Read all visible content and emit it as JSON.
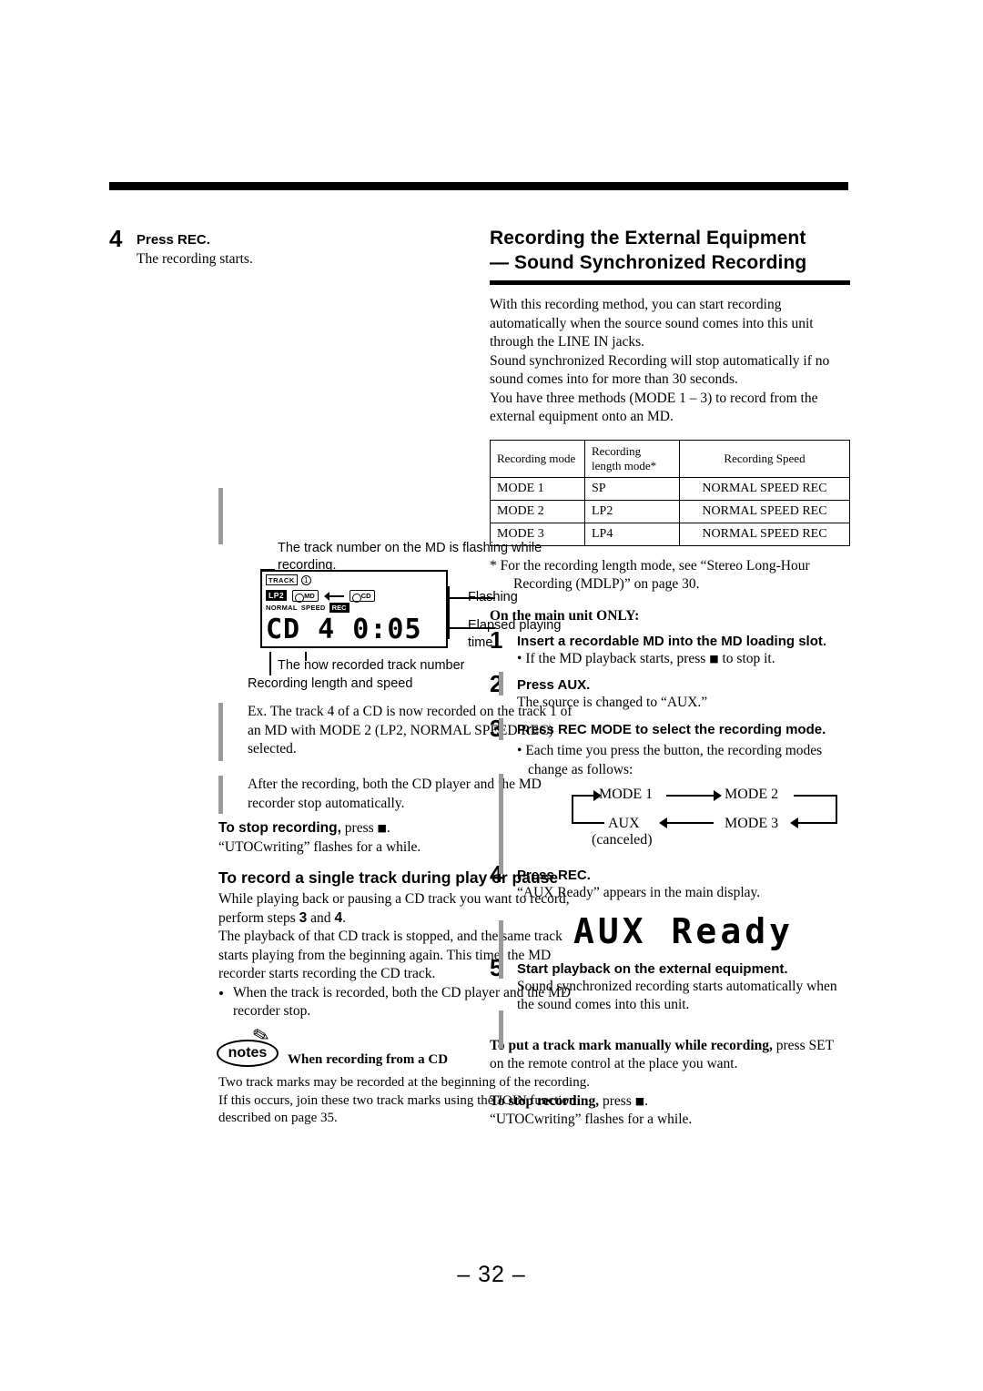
{
  "page_number": "– 32 –",
  "left": {
    "step4": {
      "num": "4",
      "head": "Press REC.",
      "body": "The recording starts."
    },
    "callout_track_flash": "The track number on the MD is flashing while recording.",
    "callout_flashing": "Flashing",
    "callout_elapsed": "Elapsed playing time",
    "callout_now_recorded": "The now recorded track number",
    "callout_length_speed": "Recording length and speed",
    "lcd": {
      "track_label": "TRACK",
      "track_circle": "1",
      "lp2": "LP2",
      "md": "MD",
      "cd": "CD",
      "normal": "NORMAL",
      "speed": "SPEED",
      "rec": "REC",
      "main_text": "CD  4  0:05"
    },
    "example": "Ex. The track 4 of a CD is now recorded on the track 1 of an MD with MODE 2 (LP2, NORMAL SPEED REC) selected.",
    "after_rec": "After the recording, both the CD player and the MD recorder stop automatically.",
    "stop_rec_bold": "To stop recording,",
    "stop_rec_rest": "press",
    "stop_rec_after": ".",
    "utoc": "“UTOCwriting” flashes for a while.",
    "single_track_heading": "To record a single track during play or pause",
    "single_p1_a": "While playing back or pausing a CD track you want to record, perform steps",
    "single_p1_n1": "3",
    "single_p1_b": "and",
    "single_p1_n2": "4",
    "single_p1_c": ".",
    "single_p2": "The playback of that CD track is stopped, and the same track starts playing from the beginning again. This time, the MD recorder starts recording the CD track.",
    "single_bullet": "When the track is recorded, both the CD player and the MD recorder stop.",
    "notes_label": "notes",
    "notes_title": "When recording from a CD",
    "notes_body": "Two track marks may be recorded at the beginning of the recording. If this occurs, join these two track marks using the JOIN function described on page 35."
  },
  "right": {
    "section_title_line1": "Recording the External Equipment",
    "section_title_line2": "— Sound Synchronized Recording",
    "intro1": "With this recording method, you can start recording automatically when the source sound comes into this unit through the LINE IN jacks.",
    "intro2": "Sound synchronized Recording will stop automatically if no sound comes into for more than 30 seconds.",
    "intro3": "You have three methods (MODE 1 – 3) to record from the external equipment onto an MD.",
    "table": {
      "headers": [
        "Recording mode",
        "Recording length mode*",
        "Recording Speed"
      ],
      "rows": [
        [
          "MODE 1",
          "SP",
          "NORMAL SPEED REC"
        ],
        [
          "MODE 2",
          "LP2",
          "NORMAL SPEED REC"
        ],
        [
          "MODE 3",
          "LP4",
          "NORMAL SPEED REC"
        ]
      ]
    },
    "footnote": "* For the recording length mode, see “Stereo Long-Hour Recording (MDLP)” on page 30.",
    "main_unit_only": "On the main unit ONLY:",
    "step1": {
      "num": "1",
      "head": "Insert a recordable MD into the MD loading slot.",
      "bullet_a": "If the MD playback starts, press",
      "bullet_b": "to stop it."
    },
    "step2": {
      "num": "2",
      "head": "Press AUX.",
      "body": "The source is changed to “AUX.”"
    },
    "step3": {
      "num": "3",
      "head": "Press REC MODE to select the recording mode.",
      "bullet": "Each time you press the button, the recording modes change as follows:",
      "flow": {
        "mode1": "MODE 1",
        "mode2": "MODE 2",
        "mode3": "MODE 3",
        "aux": "AUX",
        "canceled": "(canceled)"
      }
    },
    "step4": {
      "num": "4",
      "head": "Press REC.",
      "body": "“AUX Ready” appears in the main display.",
      "display_text": "AUX  Ready"
    },
    "step5": {
      "num": "5",
      "head": "Start playback on the external equipment.",
      "body": "Sound synchronized recording starts automatically when the sound comes into this unit."
    },
    "track_mark_bold": "To put a track mark manually while recording,",
    "track_mark_rest": "press SET on the remote control at the place you want.",
    "stop_rec_bold": "To stop recording,",
    "stop_rec_rest": "press",
    "stop_rec_after": ".",
    "utoc": "“UTOCwriting” flashes for a while."
  }
}
